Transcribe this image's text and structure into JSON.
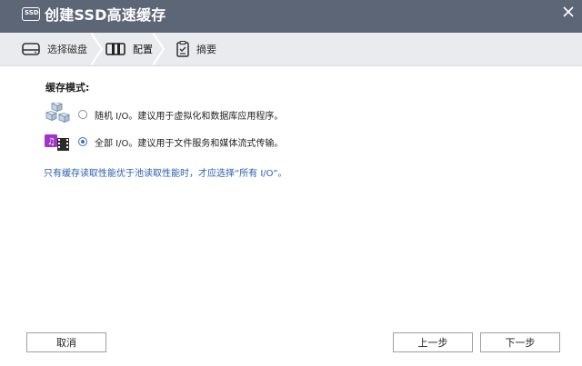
{
  "window": {
    "title": "创建SSD高速缓存",
    "title_icon_text": "SSD"
  },
  "stepper": {
    "steps": [
      {
        "label": "选择磁盘",
        "icon": "disk-icon"
      },
      {
        "label": "配置",
        "icon": "config-icon"
      },
      {
        "label": "摘要",
        "icon": "summary-icon"
      }
    ],
    "active_index": 1
  },
  "content": {
    "section_title": "缓存模式:",
    "options": [
      {
        "label": "随机 I/O。建议用于虚拟化和数据库应用程序。",
        "icon": "random-io-icon",
        "selected": false
      },
      {
        "label": "全部 I/O。建议用于文件服务和媒体流式传输。",
        "icon": "media-icon",
        "selected": true
      }
    ],
    "note": "只有缓存读取性能优于池读取性能时，才应选择“所有 I/O”。"
  },
  "footer": {
    "cancel_label": "取消",
    "prev_label": "上一步",
    "next_label": "下一步"
  },
  "colors": {
    "titlebar": "#5d6677",
    "accent": "#3a6fc4",
    "note_text": "#2a5eb1"
  }
}
